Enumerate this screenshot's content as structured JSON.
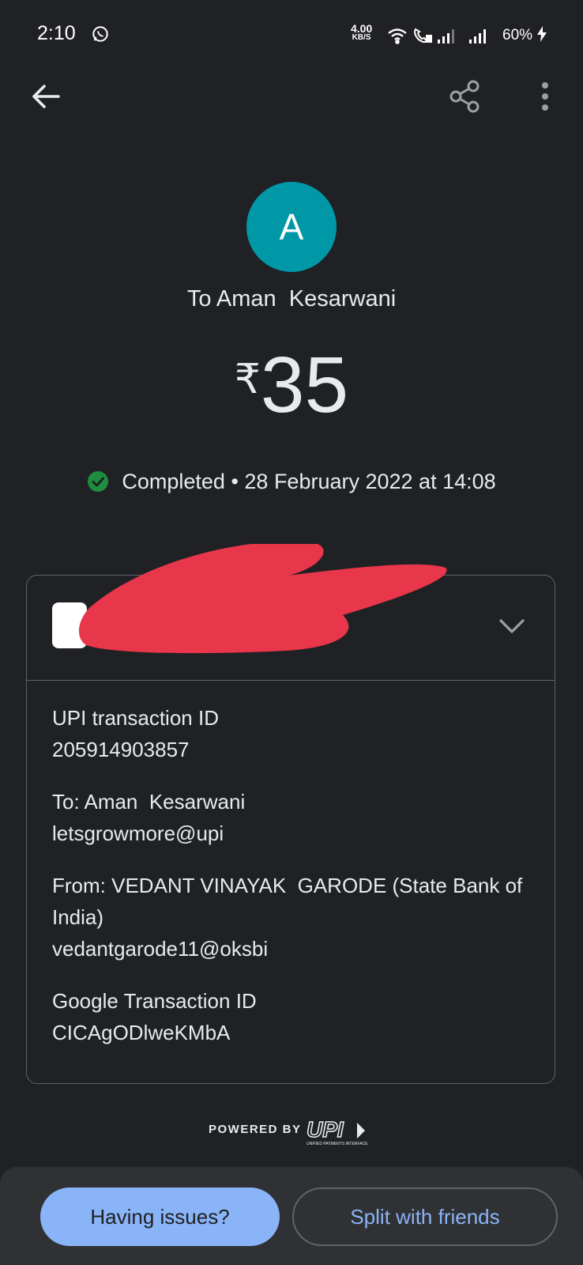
{
  "status_bar": {
    "time": "2:10",
    "net_speed_value": "4.00",
    "net_speed_unit": "KB/S",
    "battery": "60%",
    "icons": [
      "whatsapp-icon",
      "wifi-icon",
      "volte-call-icon",
      "signal-icon",
      "signal-icon",
      "charging-icon"
    ]
  },
  "app_bar": {
    "back_icon": "arrow-left-icon",
    "share_icon": "share-icon",
    "more_icon": "more-vert-icon"
  },
  "header": {
    "avatar_letter": "A",
    "avatar_color": "#0097a7",
    "payee": "To Aman  Kesarwani",
    "currency": "₹",
    "amount": "35",
    "status": "Completed",
    "separator": "•",
    "datetime": "28 February 2022 at 14:08",
    "status_color": "#1e8e3e"
  },
  "card": {
    "redaction_color": "#e8364a",
    "rows": [
      {
        "label": "UPI transaction ID",
        "value": "205914903857"
      },
      {
        "label": "To: Aman  Kesarwani",
        "value": "letsgrowmore@upi"
      },
      {
        "label": "From: VEDANT VINAYAK  GARODE (State Bank of India)",
        "value": "vedantgarode11@oksbi"
      },
      {
        "label": "Google Transaction ID",
        "value": "CICAgODlweKMbA"
      }
    ]
  },
  "footer": {
    "powered_by": "POWERED BY",
    "upi_text": "UPI",
    "upi_subtext": "UNIFIED PAYMENTS INTERFACE"
  },
  "actions": {
    "issues": "Having issues?",
    "split": "Split with friends",
    "accent": "#8ab4f8"
  }
}
